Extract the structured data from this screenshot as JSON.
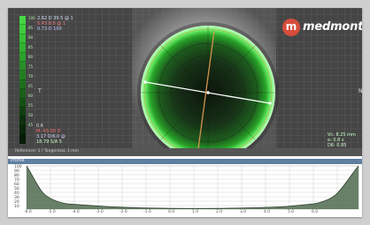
{
  "app": {
    "brand": "medmont",
    "logo_mark": "m"
  },
  "viewer": {
    "top_left_lines": [
      "2.62 D 39.5 @ 1",
      "5.43 8.0 @ 1",
      "0.73 D 100"
    ],
    "left_axis_label": "T",
    "right_axis_label": "N",
    "bottom_left_lines": [
      "0.6",
      "M: 43.00 D",
      "3.17 D/6.0 @",
      "18.79 S/A 5"
    ],
    "bottom_right_lines": [
      "Vc: 8.25 mm",
      "e: 0.8 s",
      "D6: 0.85"
    ],
    "scale_ticks": [
      "100",
      "95",
      "90",
      "85",
      "80",
      "75",
      "70",
      "65",
      "60",
      "55",
      "50",
      "45",
      "40",
      "35",
      "30",
      "25",
      "20",
      "15",
      "10",
      "5"
    ],
    "status_text": "Reference: 1 / Tangential, 1 mm"
  },
  "chart": {
    "title": "Profile",
    "y_ticks": [
      "100",
      "90",
      "80",
      "70",
      "60",
      "50",
      "40",
      "30",
      "20",
      "10"
    ],
    "x_ticks": [
      "-6.0",
      "-5.0",
      "-4.0",
      "-3.0",
      "-2.0",
      "-1.0",
      "0.0",
      "1.0",
      "2.0",
      "3.0",
      "4.0",
      "5.0",
      "6.0"
    ],
    "fill_color": "#4f6a4f"
  },
  "colors": {
    "ring_outer": "#2bd42b",
    "ring_inner": "#0a1a0a",
    "meridian_orange": "#d1944c",
    "meridian_white": "#ffffff"
  }
}
